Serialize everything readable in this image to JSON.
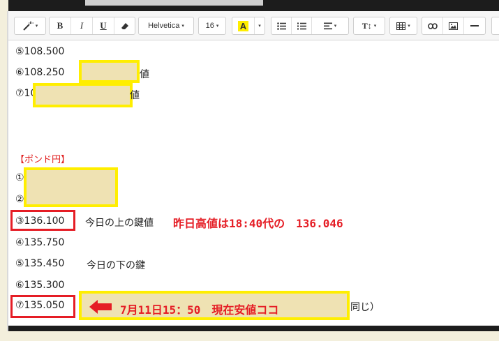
{
  "toolbar": {
    "magic": "magic-wand",
    "bold": "B",
    "italic": "I",
    "underline": "U",
    "font_family": "Helvetica",
    "font_size": "16",
    "color_letter": "A",
    "text_size": "T↕",
    "caret": "▾"
  },
  "lines": {
    "l5": "⑤108.500",
    "l6": "⑥108.250",
    "l6_tail": "値",
    "l7": "⑦10",
    "l7_tail": "値"
  },
  "pound": {
    "header": "【ポンド円】",
    "l1": "①",
    "l2": "②",
    "l3": "③136.100",
    "l3_note": "今日の上の鍵値",
    "l3_annot": "昨日高値は18:40代の　136.046",
    "l4": "④135.750",
    "l5": "⑤135.450",
    "l5_note": "今日の下の鍵",
    "l6": "⑥135.300",
    "l7": "⑦135.050",
    "l7_annot": "7月11日15：50　現在安値ココ",
    "l7_tail": "同じ）"
  },
  "colors": {
    "annotation_red": "#e51d25",
    "highlight_border": "#ffee00",
    "highlight_fill": "#efe2b3",
    "header_red": "#e02020"
  }
}
